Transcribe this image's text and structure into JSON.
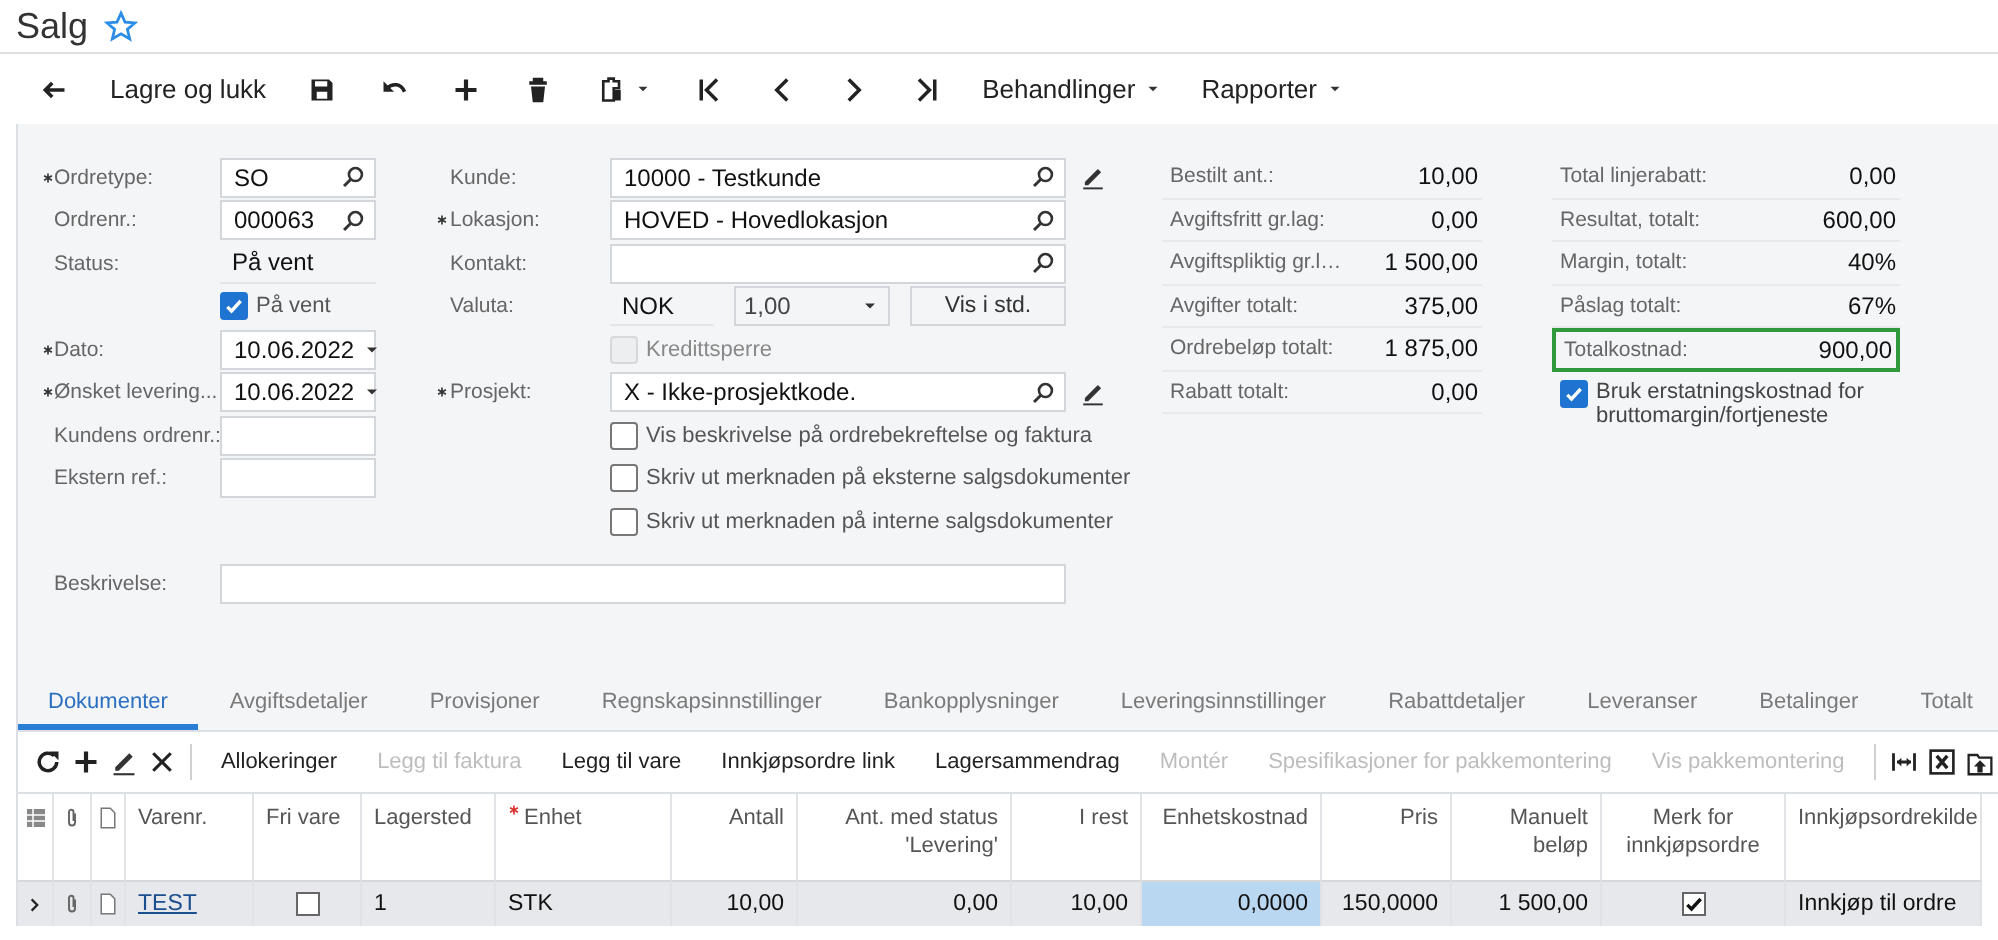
{
  "screen": {
    "title": "Salg",
    "favorite": false
  },
  "toolbar": {
    "save_close": "Lagre og lukk",
    "menus": [
      "Behandlinger",
      "Rapporter"
    ]
  },
  "form": {
    "left": [
      {
        "kind": "lookup",
        "label": "Ordretype:",
        "required": true,
        "value": "SO"
      },
      {
        "kind": "lookup",
        "label": "Ordrenr.:",
        "required": false,
        "value": "000063"
      },
      {
        "kind": "static",
        "label": "Status:",
        "required": false,
        "value": "På vent"
      },
      {
        "kind": "checkbox",
        "label": "På vent",
        "checked": true,
        "disabled": false
      },
      {
        "kind": "date",
        "label": "Dato:",
        "required": true,
        "value": "10.06.2022"
      },
      {
        "kind": "date",
        "label": "Ønsket levering...",
        "required": true,
        "value": "10.06.2022"
      },
      {
        "kind": "text",
        "label": "Kundens ordrenr.:",
        "required": false
      },
      {
        "kind": "text",
        "label": "Ekstern ref.:",
        "required": false
      }
    ],
    "middle": [
      {
        "kind": "lookup",
        "label": "Kunde:",
        "required": false,
        "value": "10000 - Testkunde",
        "editable": true
      },
      {
        "kind": "lookup",
        "label": "Lokasjon:",
        "required": true,
        "value": "HOVED - Hovedlokasjon",
        "editable": false
      },
      {
        "kind": "lookup",
        "label": "Kontakt:",
        "required": false,
        "editable": false
      },
      {
        "kind": "currency",
        "label": "Valuta:",
        "required": false,
        "currency": "NOK",
        "rate": "1,00",
        "button": "Vis i std."
      },
      {
        "kind": "checkbox",
        "label": "Kredittsperre",
        "checked": false,
        "disabled": true
      },
      {
        "kind": "lookup",
        "label": "Prosjekt:",
        "required": true,
        "value": "X - Ikke-prosjektkode.",
        "editable": true
      },
      {
        "kind": "checkbox",
        "label": "Vis beskrivelse på ordrebekreftelse og faktura",
        "checked": false,
        "disabled": false
      },
      {
        "kind": "checkbox",
        "label": "Skriv ut merknaden på eksterne salgsdokumenter",
        "checked": false,
        "disabled": false
      },
      {
        "kind": "checkbox",
        "label": "Skriv ut merknaden på interne salgsdokumenter",
        "checked": false,
        "disabled": false
      }
    ],
    "summary_1": [
      {
        "label": "Bestilt ant.:",
        "value": "10,00",
        "highlighted": false
      },
      {
        "label": "Avgiftsfritt gr.lag:",
        "value": "0,00",
        "highlighted": false
      },
      {
        "label": "Avgiftspliktig gr.l…",
        "value": "1 500,00",
        "highlighted": false
      },
      {
        "label": "Avgifter totalt:",
        "value": "375,00",
        "highlighted": false
      },
      {
        "label": "Ordrebeløp totalt:",
        "value": "1 875,00",
        "highlighted": false
      },
      {
        "label": "Rabatt totalt:",
        "value": "0,00",
        "highlighted": false
      }
    ],
    "summary_2": [
      {
        "label": "Total linjerabatt:",
        "value": "0,00",
        "highlighted": false
      },
      {
        "label": "Resultat, totalt:",
        "value": "600,00",
        "highlighted": false
      },
      {
        "label": "Margin, totalt:",
        "value": "40%",
        "highlighted": false
      },
      {
        "label": "Påslag totalt:",
        "value": "67%",
        "highlighted": false
      },
      {
        "label": "Totalkostnad:",
        "value": "900,00",
        "highlighted": true
      }
    ],
    "summary_option": {
      "label": "Bruk erstatningskostnad for bruttomargin/fortjeneste",
      "checked": true
    },
    "description": {
      "label": "Beskrivelse:"
    }
  },
  "tabs": [
    {
      "label": "Dokumenter",
      "selected": true
    },
    {
      "label": "Avgiftsdetaljer",
      "selected": false
    },
    {
      "label": "Provisjoner",
      "selected": false
    },
    {
      "label": "Regnskapsinnstillinger",
      "selected": false
    },
    {
      "label": "Bankopplysninger",
      "selected": false
    },
    {
      "label": "Leveringsinnstillinger",
      "selected": false
    },
    {
      "label": "Rabattdetaljer",
      "selected": false
    },
    {
      "label": "Leveranser",
      "selected": false
    },
    {
      "label": "Betalinger",
      "selected": false
    },
    {
      "label": "Totalt",
      "selected": false
    }
  ],
  "grid_toolbar": [
    {
      "label": "Allokeringer",
      "disabled": false
    },
    {
      "label": "Legg til faktura",
      "disabled": true
    },
    {
      "label": "Legg til vare",
      "disabled": false
    },
    {
      "label": "Innkjøpsordre link",
      "disabled": false
    },
    {
      "label": "Lagersammendrag",
      "disabled": false
    },
    {
      "label": "Montér",
      "disabled": true
    },
    {
      "label": "Spesifikasjoner for pakkemontering",
      "disabled": true
    },
    {
      "label": "Vis pakkemontering",
      "disabled": true
    }
  ],
  "grid": {
    "columns": [
      {
        "label": "Varenr.",
        "kind": "link",
        "required": false
      },
      {
        "label": "Fri vare",
        "kind": "check",
        "required": false
      },
      {
        "label": "Lagersted",
        "kind": "text",
        "required": false
      },
      {
        "label": "Enhet",
        "kind": "text",
        "required": true
      },
      {
        "label": "Antall",
        "kind": "number",
        "required": false
      },
      {
        "label": "Ant. med status 'Levering'",
        "kind": "number",
        "required": false
      },
      {
        "label": "I rest",
        "kind": "number",
        "required": false
      },
      {
        "label": "Enhetskostnad",
        "kind": "number",
        "required": false
      },
      {
        "label": "Pris",
        "kind": "number",
        "required": false
      },
      {
        "label": "Manuelt beløp",
        "kind": "number",
        "required": false
      },
      {
        "label": "Merk for innkjøpsordre",
        "kind": "center",
        "required": false
      },
      {
        "label": "Innkjøpsordrekilde",
        "kind": "text",
        "required": false
      }
    ],
    "rows": [
      {
        "current": true,
        "cells": [
          {
            "text": "TEST",
            "selected": false
          },
          {
            "checked": false,
            "selected": false
          },
          {
            "text": "1",
            "selected": false
          },
          {
            "text": "STK",
            "selected": false
          },
          {
            "text": "10,00",
            "selected": false
          },
          {
            "text": "0,00",
            "selected": false
          },
          {
            "text": "10,00",
            "selected": false
          },
          {
            "text": "0,0000",
            "selected": true
          },
          {
            "text": "150,0000",
            "selected": false
          },
          {
            "text": "1 500,00",
            "selected": false
          },
          {
            "checked": true,
            "selected": false
          },
          {
            "text": "Innkjøp til ordre",
            "selected": false
          }
        ]
      }
    ]
  }
}
